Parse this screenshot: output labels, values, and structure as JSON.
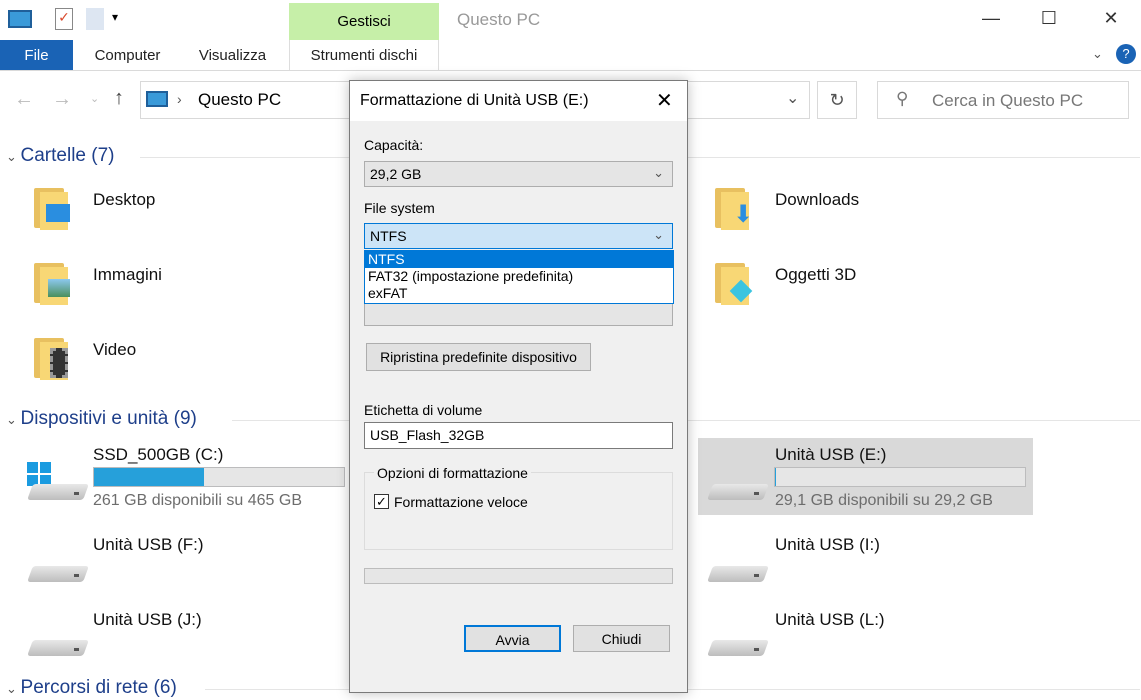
{
  "window": {
    "title": "Questo PC",
    "contextual_tab": "Gestisci"
  },
  "ribbon": {
    "tabs": [
      "File",
      "Computer",
      "Visualizza",
      "Strumenti dischi"
    ]
  },
  "address": {
    "path": "Questo PC",
    "search_placeholder": "Cerca in Questo PC"
  },
  "folders": {
    "header": "Cartelle (7)",
    "items": [
      "Desktop",
      "Downloads",
      "Immagini",
      "Oggetti 3D",
      "Video"
    ]
  },
  "devices": {
    "header": "Dispositivi e unità (9)",
    "items": [
      {
        "name": "SSD_500GB (C:)",
        "free": "261 GB disponibili su 465 GB",
        "used_pct": 44
      },
      {
        "name": "Unità USB (E:)",
        "free": "29,1 GB disponibili su 29,2 GB",
        "used_pct": 0.5
      },
      {
        "name": "Unità USB (F:)"
      },
      {
        "name": "Unità USB (I:)"
      },
      {
        "name": "Unità USB (J:)"
      },
      {
        "name": "Unità USB (L:)"
      }
    ]
  },
  "network": {
    "header": "Percorsi di rete (6)"
  },
  "dialog": {
    "title": "Formattazione di Unità USB (E:)",
    "capacity_label": "Capacità:",
    "capacity_value": "29,2 GB",
    "fs_label": "File system",
    "fs_value": "NTFS",
    "fs_options": [
      "NTFS",
      "FAT32 (impostazione predefinita)",
      "exFAT"
    ],
    "restore_button": "Ripristina predefinite dispositivo",
    "volume_label": "Etichetta di volume",
    "volume_value": "USB_Flash_32GB",
    "options_group": "Opzioni di formattazione",
    "quick_format": "Formattazione veloce",
    "quick_format_checked": true,
    "progress": 0,
    "start_button": "Avvia",
    "close_button": "Chiudi"
  },
  "colors": {
    "accent": "#0063b1",
    "manage_tab": "#c6efa8",
    "selection": "#0078d7"
  }
}
